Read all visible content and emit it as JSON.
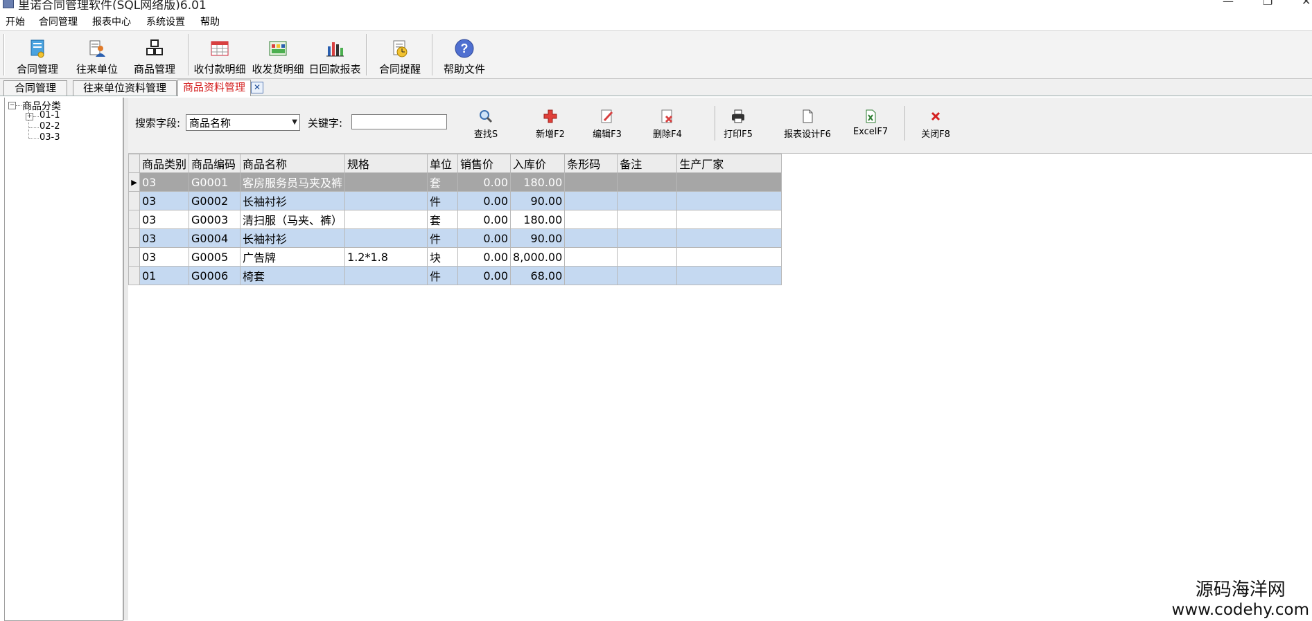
{
  "window": {
    "title": "里诺合同管理软件(SQL网络版)6.01",
    "minimize_glyph": "—",
    "restore_glyph": "❐",
    "close_glyph": "✕"
  },
  "menu": [
    "开始",
    "合同管理",
    "报表中心",
    "系统设置",
    "帮助"
  ],
  "toolbar": {
    "buttons": [
      {
        "label": "合同管理",
        "icon": "contract-icon"
      },
      {
        "label": "往来单位",
        "icon": "contacts-icon"
      },
      {
        "label": "商品管理",
        "icon": "products-icon"
      },
      {
        "label": "收付款明细",
        "icon": "payment-detail-icon"
      },
      {
        "label": "收发货明细",
        "icon": "shipment-detail-icon"
      },
      {
        "label": "日回款报表",
        "icon": "bar-chart-icon"
      },
      {
        "label": "合同提醒",
        "icon": "reminder-icon"
      },
      {
        "label": "帮助文件",
        "icon": "help-icon"
      }
    ]
  },
  "tabs": [
    {
      "label": "合同管理",
      "active": false
    },
    {
      "label": "往来单位资料管理",
      "active": false
    },
    {
      "label": "商品资料管理",
      "active": true
    }
  ],
  "tab_close_glyph": "✕",
  "tree": {
    "root": {
      "label": "商品分类",
      "toggle": "−"
    },
    "children": [
      {
        "label": "01-1",
        "toggle": "+"
      },
      {
        "label": "02-2"
      },
      {
        "label": "03-3"
      }
    ]
  },
  "search": {
    "field_label": "搜索字段:",
    "field_value": "商品名称",
    "keyword_label": "关键字:",
    "keyword_value": "",
    "buttons": [
      {
        "label": "查找S",
        "icon": "search-icon"
      },
      {
        "label": "新增F2",
        "icon": "add-icon"
      },
      {
        "label": "编辑F3",
        "icon": "edit-icon"
      },
      {
        "label": "删除F4",
        "icon": "delete-icon"
      },
      {
        "label": "打印F5",
        "icon": "print-icon"
      },
      {
        "label": "报表设计F6",
        "icon": "report-design-icon"
      },
      {
        "label": "ExcelF7",
        "icon": "excel-icon"
      },
      {
        "label": "关闭F8",
        "icon": "close-icon"
      }
    ]
  },
  "grid": {
    "columns": [
      "商品类别",
      "商品编码",
      "商品名称",
      "规格",
      "单位",
      "销售价",
      "入库价",
      "条形码",
      "备注",
      "生产厂家"
    ],
    "current_row_marker": "▶",
    "rows": [
      [
        "03",
        "G0001",
        "客房服务员马夹及裤",
        "",
        "套",
        "0.00",
        "180.00",
        "",
        "",
        ""
      ],
      [
        "03",
        "G0002",
        "长袖衬衫",
        "",
        "件",
        "0.00",
        "90.00",
        "",
        "",
        ""
      ],
      [
        "03",
        "G0003",
        "清扫服（马夹、裤）",
        "",
        "套",
        "0.00",
        "180.00",
        "",
        "",
        ""
      ],
      [
        "03",
        "G0004",
        "长袖衬衫",
        "",
        "件",
        "0.00",
        "90.00",
        "",
        "",
        ""
      ],
      [
        "03",
        "G0005",
        "广告牌",
        "1.2*1.8",
        "块",
        "0.00",
        "8,000.00",
        "",
        "",
        ""
      ],
      [
        "01",
        "G0006",
        "椅套",
        "",
        "件",
        "0.00",
        "68.00",
        "",
        "",
        ""
      ]
    ]
  },
  "watermark": {
    "line1": "源码海洋网",
    "line2": "www.codehy.com"
  }
}
